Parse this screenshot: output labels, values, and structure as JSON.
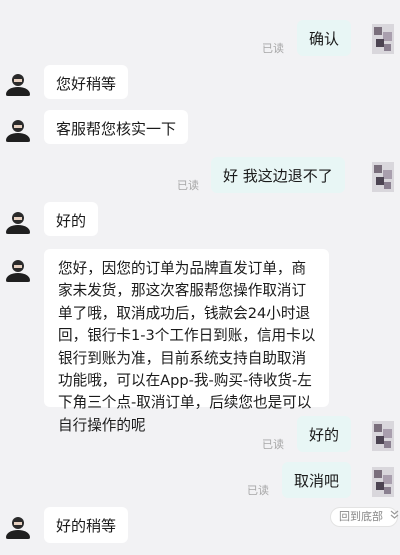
{
  "read_label": "已读",
  "messages": {
    "m1": {
      "sender": "me",
      "text": "确认"
    },
    "m2": {
      "sender": "agent",
      "text": "您好稍等"
    },
    "m3": {
      "sender": "agent",
      "text": "客服帮您核实一下"
    },
    "m4": {
      "sender": "me",
      "text": "好 我这边退不了"
    },
    "m5": {
      "sender": "agent",
      "text": "好的"
    },
    "m6": {
      "sender": "agent",
      "text": "您好，因您的订单为品牌直发订单，商家未发货，那这次客服帮您操作取消订单了哦，取消成功后，钱款会24小时退回，银行卡1-3个工作日到账，信用卡以银行到账为准，目前系统支持自助取消功能哦，可以在App-我-购买-待收货-左下角三个点-取消订单，后续您也是可以自行操作的呢"
    },
    "m7": {
      "sender": "me",
      "text": "好的"
    },
    "m8": {
      "sender": "me",
      "text": "取消吧"
    },
    "m9": {
      "sender": "agent",
      "text": "好的稍等"
    }
  },
  "scroll_bottom": {
    "label": "回到底部",
    "icon": "double-chevron-down-icon"
  },
  "colors": {
    "background": "#f2f2f4",
    "agent_bubble": "#ffffff",
    "user_bubble": "#e8f6f5",
    "read_text": "#a7a7a7"
  }
}
